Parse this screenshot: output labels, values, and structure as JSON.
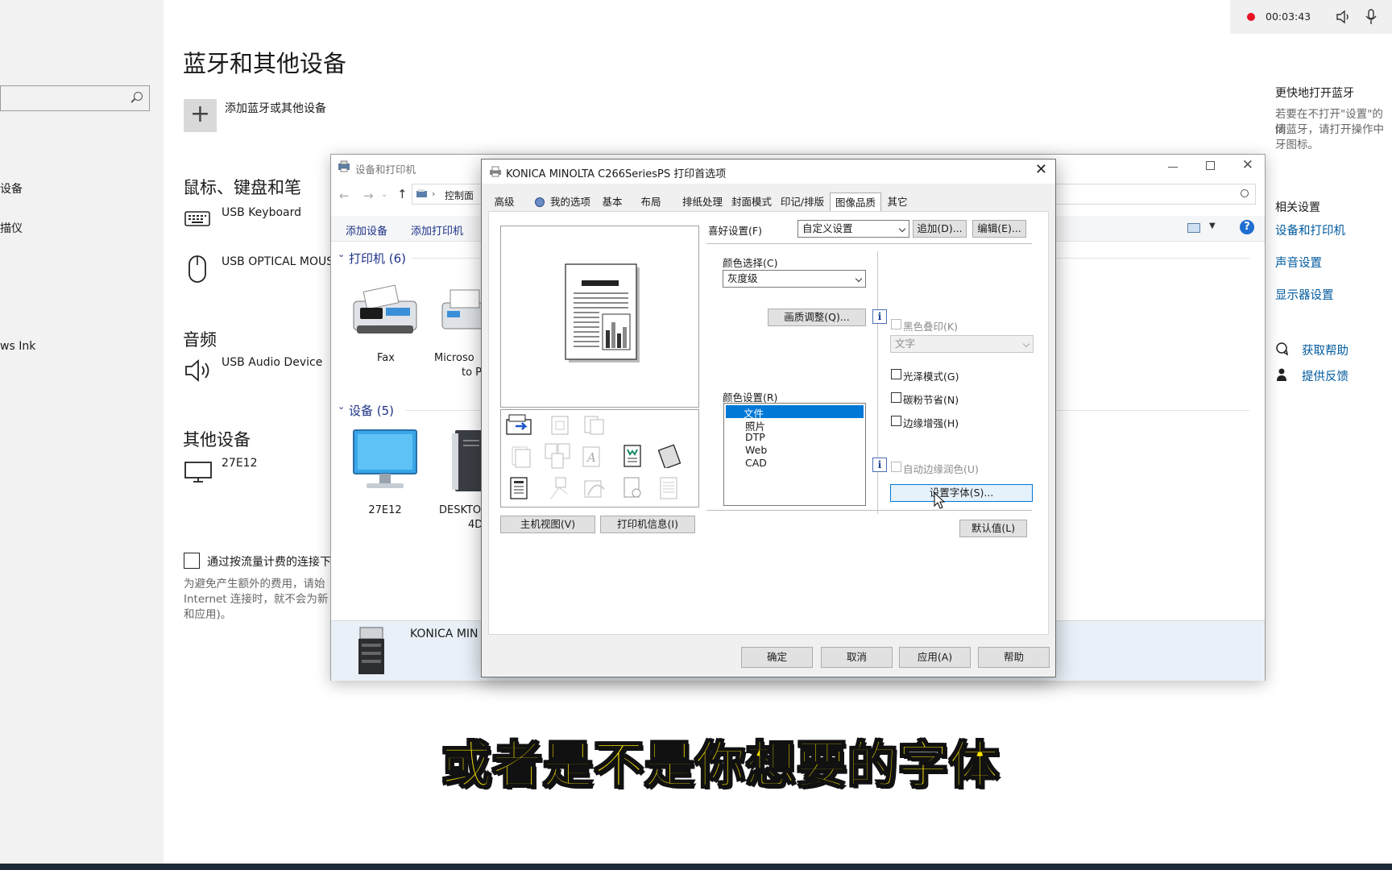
{
  "settings": {
    "page_title": "蓝牙和其他设备",
    "add_device_label": "添加蓝牙或其他设备",
    "nav_items": [
      "设备",
      "描仪",
      "ws Ink"
    ],
    "sections": {
      "input": {
        "title": "鼠标、键盘和笔",
        "devices": [
          "USB Keyboard",
          "USB OPTICAL MOUSE"
        ]
      },
      "audio": {
        "title": "音频",
        "devices": [
          "USB Audio Device"
        ]
      },
      "other": {
        "title": "其他设备",
        "devices": [
          "27E12"
        ]
      }
    },
    "metered": {
      "checkbox_label": "通过按流量计费的连接下",
      "desc_line1": "为避免产生额外的费用，请始",
      "desc_line2": "Internet 连接时，就不会为新",
      "desc_line3": "和应用)。"
    }
  },
  "right_rail": {
    "recording_time": "00:03:43",
    "bt_title": "更快地打开蓝牙",
    "bt_desc_line1": "若要在不打开\"设置\"的情",
    "bt_desc_line2": "闭蓝牙，请打开操作中",
    "bt_desc_line3": "牙图标。",
    "related_title": "相关设置",
    "links": [
      "设备和打印机",
      "声音设置",
      "显示器设置"
    ],
    "help_link": "获取帮助",
    "feedback_link": "提供反馈"
  },
  "devices_window": {
    "title": "设备和打印机",
    "breadcrumb": "控制面",
    "toolbar": [
      "添加设备",
      "添加打印机"
    ],
    "printers_group": "打印机 (6)",
    "printers": [
      "Fax",
      "Microso",
      "to P"
    ],
    "devices_group": "设备 (5)",
    "devices": [
      "27E12",
      "DESKTO",
      "4D"
    ],
    "selected_printer": "KONICA MIN"
  },
  "dialog": {
    "title": "KONICA MINOLTA C266SeriesPS 打印首选项",
    "tabs": [
      "高级",
      "我的选项",
      "基本",
      "布局",
      "排纸处理",
      "封面模式",
      "印记/排版",
      "图像品质",
      "其它"
    ],
    "active_tab": "图像品质",
    "favorite_label": "喜好设置(F)",
    "favorite_value": "自定义设置",
    "add_btn": "追加(D)...",
    "edit_btn": "编辑(E)...",
    "color_select_label": "颜色选择(C)",
    "color_select_value": "灰度级",
    "quality_btn": "画质调整(Q)...",
    "black_overprint": "黑色叠印(K)",
    "text_combo": "文字",
    "gloss_mode": "光泽模式(G)",
    "toner_save": "碳粉节省(N)",
    "edge_enhance": "边缘增强(H)",
    "auto_edge": "自动边缘润色(U)",
    "font_btn": "设置字体(S)...",
    "default_btn": "默认值(L)",
    "color_setting_label": "颜色设置(R)",
    "color_setting_items": [
      "文件",
      "照片",
      "DTP",
      "Web",
      "CAD"
    ],
    "color_setting_selected": "文件",
    "main_view_btn": "主机视图(V)",
    "printer_info_btn": "打印机信息(I)",
    "ok_btn": "确定",
    "cancel_btn": "取消",
    "apply_btn": "应用(A)",
    "help_btn": "帮助"
  },
  "subtitle": "或者是不是你想要的字体"
}
